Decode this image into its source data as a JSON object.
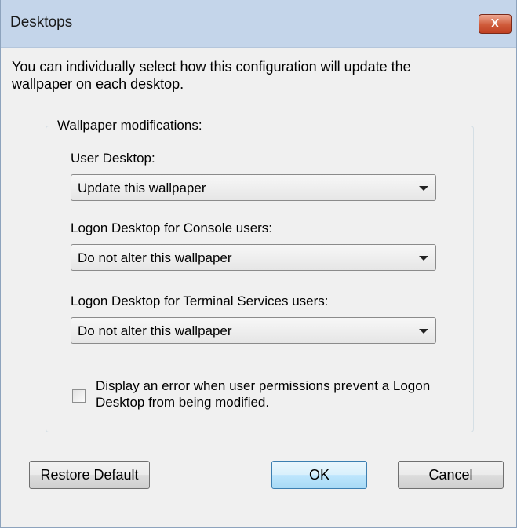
{
  "window": {
    "title": "Desktops",
    "close_label": "X"
  },
  "intro_text": "You can individually select how this configuration will update the wallpaper on each desktop.",
  "group": {
    "legend": "Wallpaper modifications:",
    "user_desktop": {
      "label": "User Desktop:",
      "value": "Update this wallpaper"
    },
    "logon_console": {
      "label": "Logon Desktop for Console users:",
      "value": "Do not alter this wallpaper"
    },
    "logon_terminal": {
      "label": "Logon Desktop for Terminal Services users:",
      "value": "Do not alter this wallpaper"
    },
    "error_checkbox": {
      "label": "Display an error when user permissions prevent a Logon Desktop from being modified.",
      "checked": false
    }
  },
  "buttons": {
    "restore": "Restore Default",
    "ok": "OK",
    "cancel": "Cancel"
  },
  "icons": {
    "close": "close-icon",
    "dropdown": "chevron-down-icon"
  }
}
